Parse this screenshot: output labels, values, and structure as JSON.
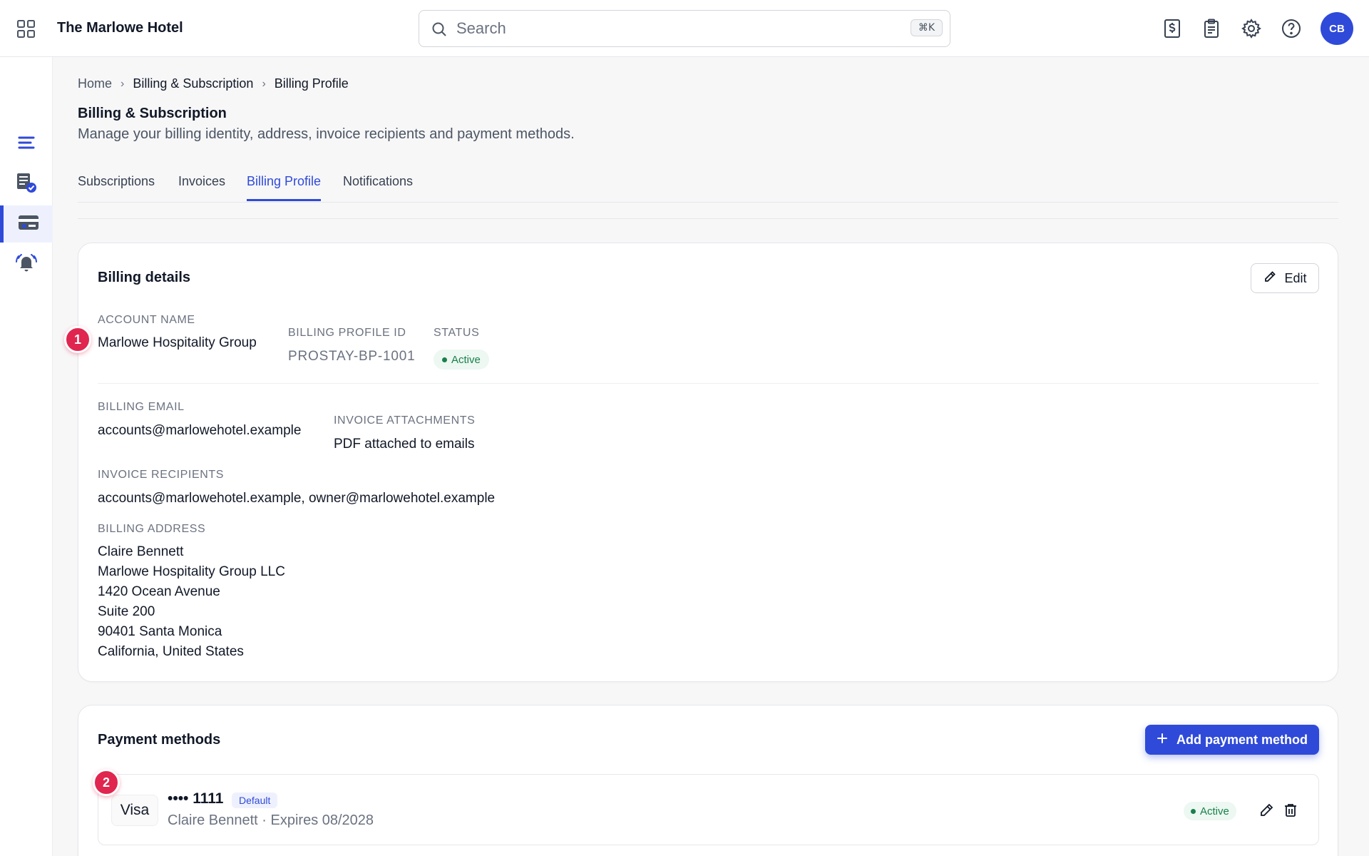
{
  "app": {
    "hotel_name": "The Marlowe Hotel",
    "search_placeholder": "Search",
    "search_shortcut": "⌘K",
    "avatar_initials": "CB",
    "accent_color": "#2f4ad9",
    "top_icons": [
      "billing-dollar-icon",
      "clipboard-icon",
      "gear-icon",
      "help-icon"
    ]
  },
  "sidebar": {
    "items": [
      {
        "icon": "menu-icon"
      },
      {
        "icon": "invoice-check-icon"
      },
      {
        "icon": "credit-card-icon",
        "active": true
      },
      {
        "icon": "bell-alert-icon"
      }
    ]
  },
  "breadcrumb": [
    "Home",
    "Billing & Subscription",
    "Billing Profile"
  ],
  "page": {
    "title": "Billing & Subscription",
    "subtitle": "Manage your billing identity, address, invoice recipients and payment methods."
  },
  "tabs": [
    {
      "label": "Subscriptions"
    },
    {
      "label": "Invoices"
    },
    {
      "label": "Billing Profile",
      "active": true
    },
    {
      "label": "Notifications"
    }
  ],
  "billing_details": {
    "title": "Billing details",
    "edit_label": "Edit",
    "account_name_label": "ACCOUNT NAME",
    "account_name": "Marlowe Hospitality Group",
    "profile_id_label": "BILLING PROFILE ID",
    "profile_id": "PROSTAY-BP-1001",
    "status_label": "STATUS",
    "status": "Active",
    "billing_email_label": "BILLING EMAIL",
    "billing_email": "accounts@marlowehotel.example",
    "attachments_label": "INVOICE ATTACHMENTS",
    "attachments": "PDF attached to emails",
    "recipients_label": "INVOICE RECIPIENTS",
    "recipients": "accounts@marlowehotel.example, owner@marlowehotel.example",
    "address_label": "BILLING ADDRESS",
    "address_lines": [
      "Claire Bennett",
      "Marlowe Hospitality Group LLC",
      "1420 Ocean Avenue",
      "Suite 200",
      "90401 Santa Monica",
      "California, United States"
    ]
  },
  "payment_methods": {
    "title": "Payment methods",
    "add_label": "Add payment method",
    "items": [
      {
        "brand": "Visa",
        "number": "•••• 1111",
        "default_label": "Default",
        "meta": "Claire Bennett · Expires 08/2028",
        "status": "Active"
      }
    ]
  },
  "markers": [
    "1",
    "2"
  ],
  "status_color": "#1a7f4b",
  "marker_color": "#e0254f"
}
